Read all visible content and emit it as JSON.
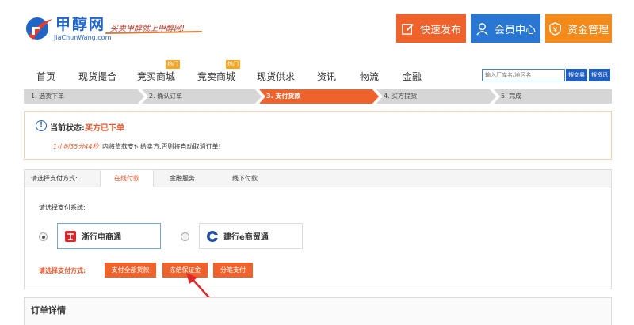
{
  "header": {
    "logo_title": "甲醇网",
    "logo_url": "JiaChunWang.com",
    "slogan": "买卖甲醇就上甲醇网!",
    "buttons": [
      {
        "label": "快速发布",
        "icon": "edit-icon"
      },
      {
        "label": "会员中心",
        "icon": "user-icon"
      },
      {
        "label": "资金管理",
        "icon": "yen-shield-icon"
      }
    ]
  },
  "nav": {
    "items": [
      "首页",
      "现货撮合",
      "竞买商城",
      "竞卖商城",
      "现货供求",
      "资讯",
      "物流",
      "金融"
    ],
    "hot_badge": "热门",
    "search_placeholder": "输入厂库名/地区名",
    "search_trade_label": "搜交易",
    "search_news_label": "搜资讯"
  },
  "steps": [
    {
      "label": "1. 选货下单",
      "active": false
    },
    {
      "label": "2. 确认订单",
      "active": false
    },
    {
      "label": "3. 支付货款",
      "active": true
    },
    {
      "label": "4. 买方提货",
      "active": false
    },
    {
      "label": "5. 完成",
      "active": false
    }
  ],
  "status": {
    "label": "当前状态:",
    "value": "买方已下单",
    "countdown": "1小时55分44秒",
    "message": "内将货款支付给卖方,否则将自动取消订单!"
  },
  "payment": {
    "tabs_label": "请选择支付方式:",
    "tabs": [
      "在线付款",
      "金融服务",
      "线下付款"
    ],
    "active_tab": "在线付款",
    "system_label": "请选择支付系统:",
    "banks": [
      {
        "name": "浙行电商通",
        "selected": true
      },
      {
        "name": "建行e商贸通",
        "selected": false
      }
    ],
    "method_label": "请选择支付方式:",
    "methods": [
      "支付全部货款",
      "冻结保证金",
      "分笔支付"
    ]
  },
  "order": {
    "title": "订单详情"
  },
  "colors": {
    "primary_orange": "#f0622c",
    "brand_blue": "#2a77d2",
    "fund_orange": "#f28a1c",
    "step_gray": "#d6d6d6"
  }
}
